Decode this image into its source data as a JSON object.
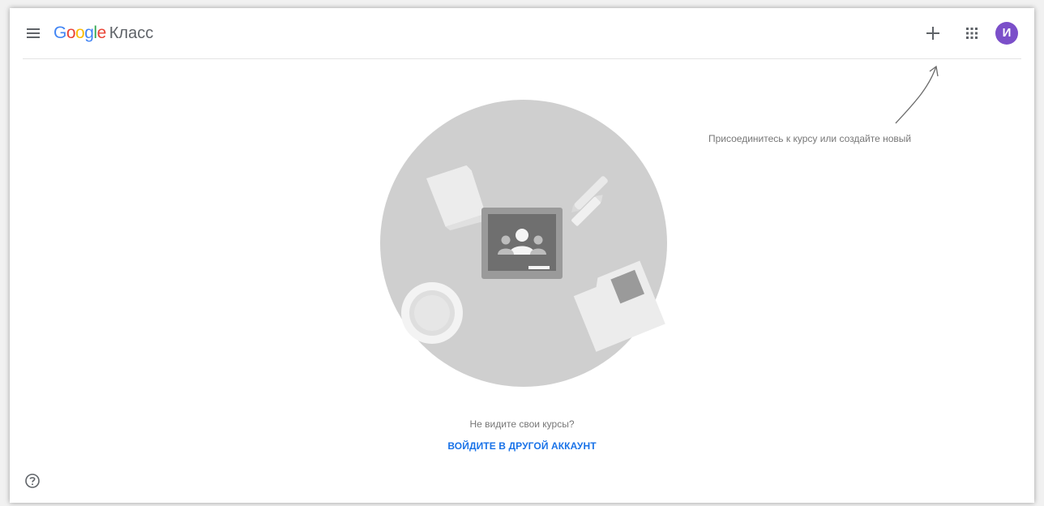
{
  "header": {
    "brand": {
      "letters": [
        {
          "ch": "G",
          "color": "#4285F4"
        },
        {
          "ch": "o",
          "color": "#EA4335"
        },
        {
          "ch": "o",
          "color": "#FBBC05"
        },
        {
          "ch": "g",
          "color": "#4285F4"
        },
        {
          "ch": "l",
          "color": "#34A853"
        },
        {
          "ch": "e",
          "color": "#EA4335"
        }
      ],
      "product": "Класс"
    },
    "menu_icon": "hamburger-menu-icon",
    "add_icon": "plus-icon",
    "apps_icon": "apps-grid-icon",
    "avatar": {
      "initial": "И",
      "color": "#7b4fc9"
    }
  },
  "hint": {
    "text": "Присоединитесь к курсу или создайте новый"
  },
  "main": {
    "no_courses_text": "Не видите свои курсы?",
    "switch_account_label": "ВОЙДИТЕ В ДРУГОЙ АККАУНТ"
  },
  "footer": {
    "help_icon": "help-circle-icon"
  },
  "colors": {
    "link": "#1a73e8",
    "illustration_circle": "#cfcfcf",
    "divider": "#e3e3e3"
  }
}
